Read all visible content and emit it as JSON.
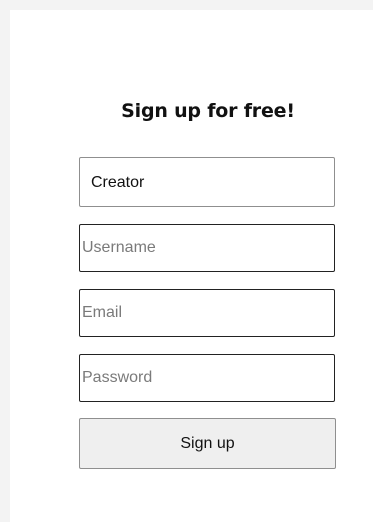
{
  "form": {
    "title": "Sign up for free!",
    "account_type": {
      "selected": "Creator"
    },
    "username": {
      "value": "",
      "placeholder": "Username"
    },
    "email": {
      "value": "",
      "placeholder": "Email"
    },
    "password": {
      "value": "",
      "placeholder": "Password"
    },
    "submit_label": "Sign up"
  },
  "colors": {
    "page_background": "#f3f3f3",
    "card_background": "#ffffff",
    "button_background": "#efefef",
    "border_dark": "#222222",
    "border_light": "#8f8f8f"
  }
}
